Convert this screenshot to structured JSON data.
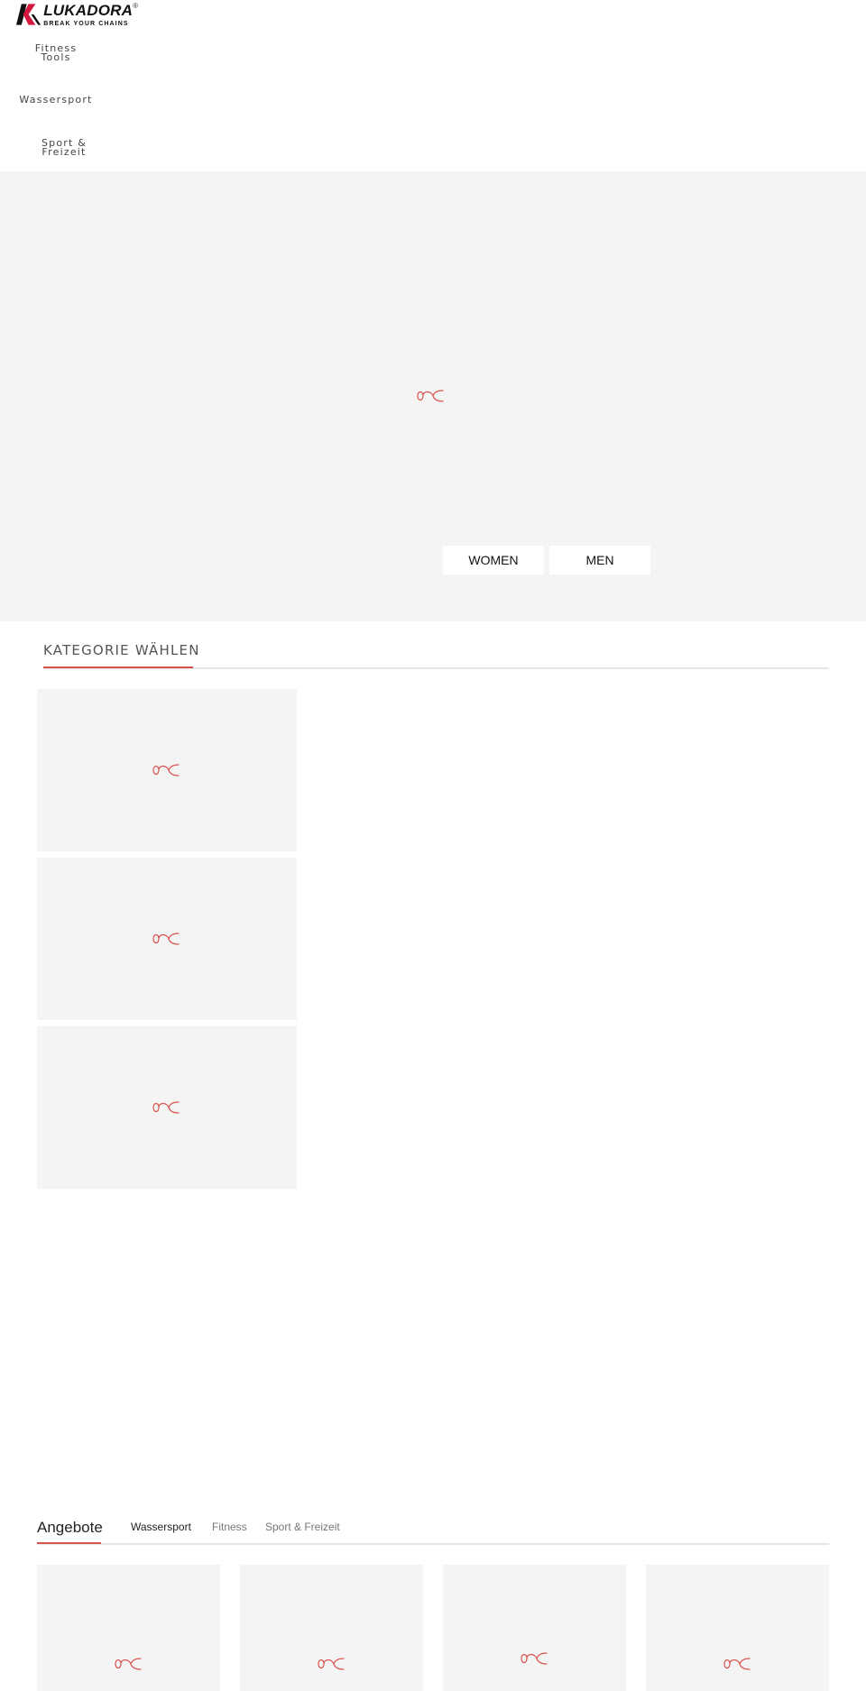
{
  "header": {
    "logo": {
      "name": "LUKADORA",
      "registered": "®",
      "tagline": "BREAK YOUR CHAINS",
      "colors": {
        "mark_red": "#d4183d",
        "mark_dark": "#111111"
      }
    },
    "nav": [
      {
        "label": "Fitness Tools"
      },
      {
        "label": "Wassersport"
      },
      {
        "label": "Sport & Freizeit"
      }
    ]
  },
  "hero": {
    "background": "#f4f4f4",
    "loading_icon": "infinity-loader-icon",
    "buttons": [
      {
        "label": "WOMEN"
      },
      {
        "label": "MEN"
      }
    ]
  },
  "categories": {
    "title": "KATEGORIE WÄHLEN",
    "accent": "#d9534f",
    "tiles": [
      {
        "loading_icon": "infinity-loader-icon"
      },
      {
        "loading_icon": "infinity-loader-icon"
      },
      {
        "loading_icon": "infinity-loader-icon"
      }
    ]
  },
  "offers": {
    "title": "Angebote",
    "tabs": [
      {
        "label": "Wassersport",
        "active": true
      },
      {
        "label": "Fitness",
        "active": false
      },
      {
        "label": "Sport & Freizeit",
        "active": false
      }
    ],
    "products": [
      {
        "loading_icon": "infinity-loader-icon"
      },
      {
        "loading_icon": "infinity-loader-icon"
      },
      {
        "loading_icon": "infinity-loader-icon"
      },
      {
        "loading_icon": "infinity-loader-icon"
      }
    ]
  }
}
